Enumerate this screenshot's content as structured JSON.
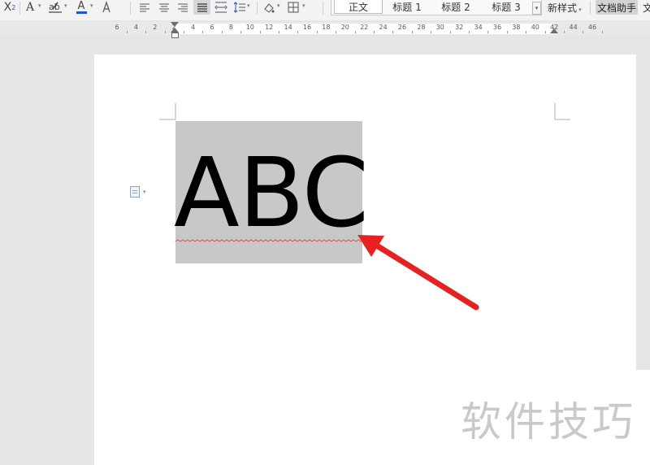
{
  "toolbar": {
    "icons": [
      "subscript-icon",
      "text-effect-icon",
      "highlight-icon",
      "font-color-icon",
      "char-shading-icon",
      "align-left-icon",
      "align-center-icon",
      "align-right-icon",
      "justify-icon",
      "distributed-icon",
      "line-spacing-icon",
      "shading-icon",
      "borders-icon"
    ],
    "font_color": "#1a56db",
    "styles": [
      "正文",
      "标题 1",
      "标题 2",
      "标题 3"
    ],
    "new_style_label": "新样式",
    "assistant_label": "文档助手",
    "overflow_label": "文"
  },
  "ruler": {
    "ticks": [
      "6",
      "4",
      "2",
      "2",
      "4",
      "6",
      "8",
      "10",
      "12",
      "14",
      "16",
      "18",
      "20",
      "22",
      "24",
      "26",
      "28",
      "30",
      "32",
      "34",
      "36",
      "38",
      "40",
      "42",
      "44",
      "46"
    ]
  },
  "document": {
    "selected_text": "ABC",
    "selection_color": "#c8c8c8",
    "spellcheck_color": "#d9534f",
    "paragraph_icon": "paragraph-menu-icon"
  },
  "annotation": {
    "arrow_color": "#e82020"
  },
  "watermark": {
    "text": "软件技巧"
  }
}
